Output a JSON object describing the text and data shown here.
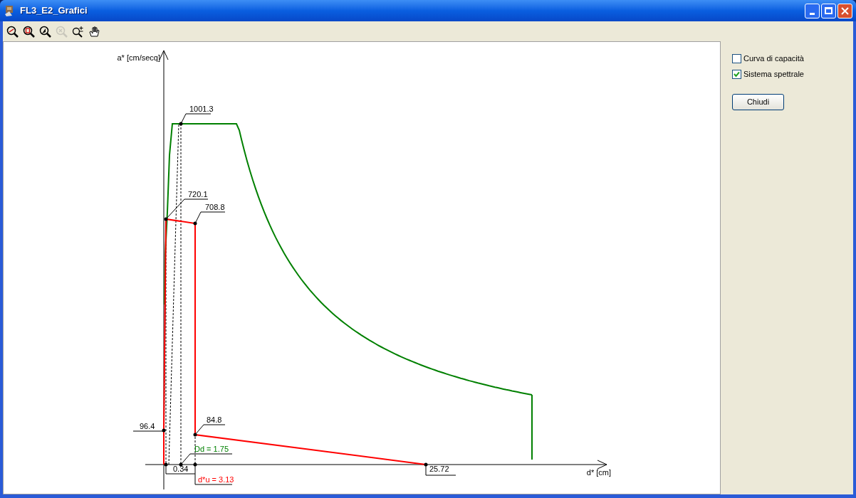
{
  "window": {
    "title": "FL3_E2_Grafici"
  },
  "toolbar": [
    {
      "disabled": false
    },
    {
      "disabled": false
    },
    {
      "disabled": false
    },
    {
      "disabled": true
    },
    {
      "disabled": false
    },
    {
      "disabled": false
    }
  ],
  "chart": {
    "y_axis_label": "a* [cm/secq]",
    "x_axis_label": "d* [cm]",
    "point_labels": [
      {
        "text": "1001.3",
        "kind": "value"
      },
      {
        "text": "720.1",
        "kind": "value"
      },
      {
        "text": "708.8",
        "kind": "value"
      },
      {
        "text": "96.4",
        "kind": "value"
      },
      {
        "text": "84.8",
        "kind": "value"
      },
      {
        "text": "Dd = 1.75",
        "kind": "demand"
      },
      {
        "text": "0.34",
        "kind": "value"
      },
      {
        "text": "d*u = 3.13",
        "kind": "capacity"
      },
      {
        "text": "25.72",
        "kind": "value"
      }
    ]
  },
  "options": [
    {
      "label": "Curva di capacità",
      "checked": false
    },
    {
      "label": "Sistema spettrale",
      "checked": true
    }
  ],
  "buttons": [
    "Chiudi"
  ]
}
